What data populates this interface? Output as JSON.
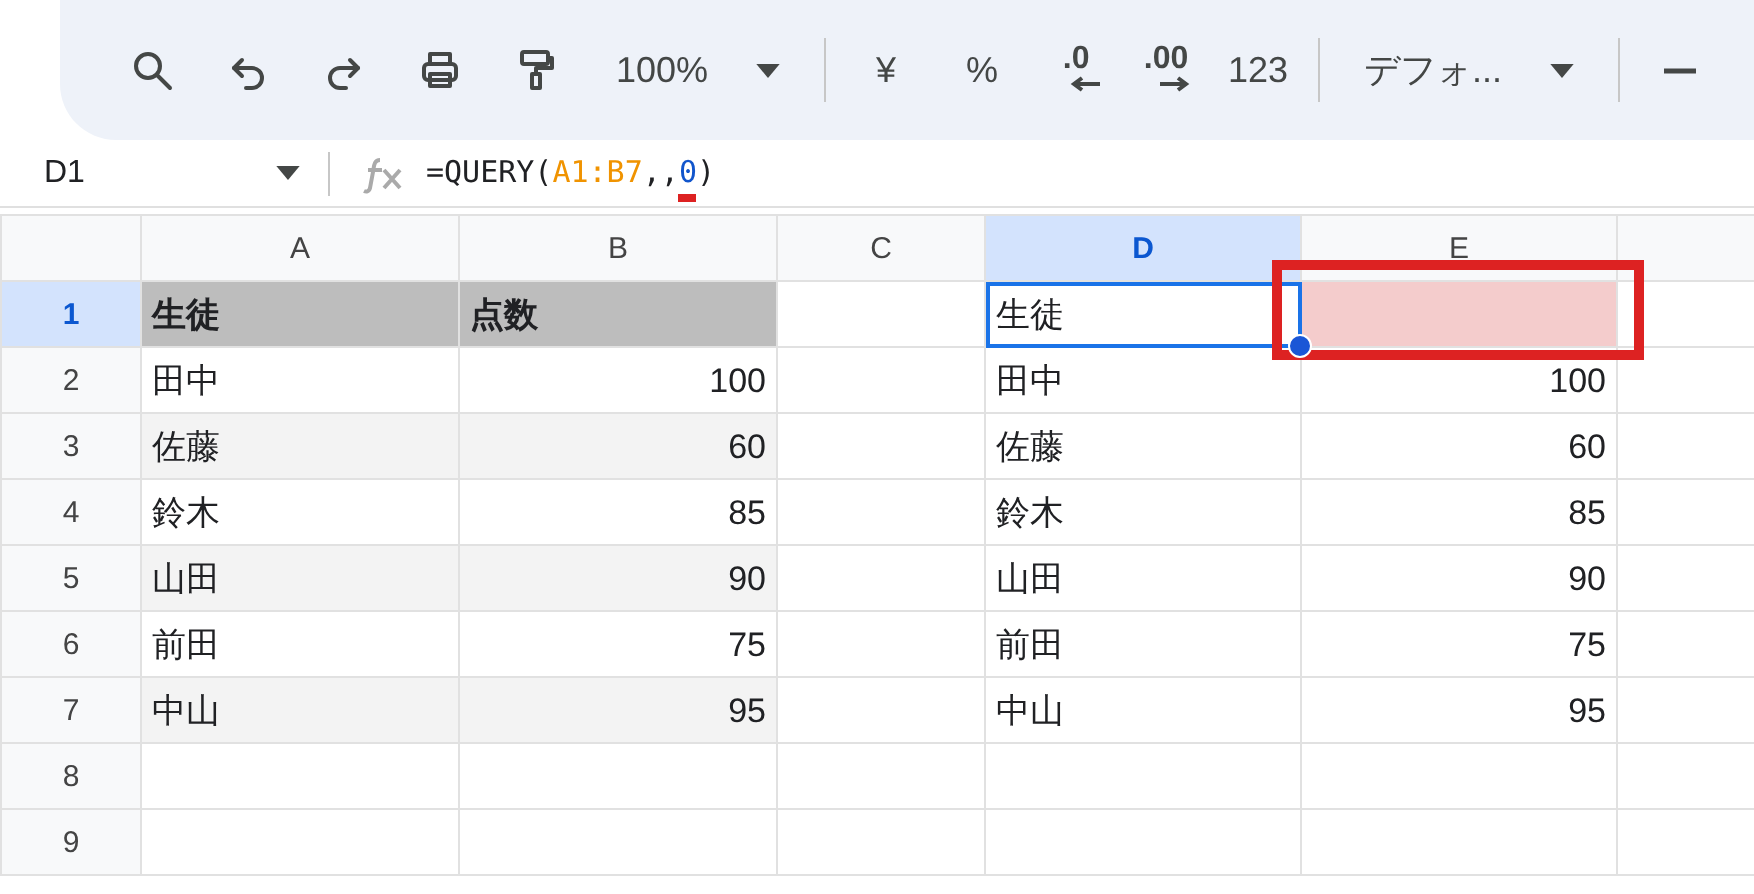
{
  "toolbar": {
    "items": [
      {
        "kind": "icon"
      },
      {
        "kind": "icon"
      },
      {
        "kind": "icon"
      },
      {
        "kind": "icon"
      },
      {
        "kind": "icon"
      },
      {
        "kind": "dropdown",
        "text": "100%"
      },
      {
        "kind": "divider"
      },
      {
        "kind": "text",
        "text": "¥"
      },
      {
        "kind": "text",
        "text": "%"
      },
      {
        "kind": "decimal",
        "text": ".0"
      },
      {
        "kind": "decimal",
        "text": ".00"
      },
      {
        "kind": "text",
        "text": "123"
      },
      {
        "kind": "divider"
      },
      {
        "kind": "dropdown",
        "text": "デフォ..."
      },
      {
        "kind": "divider"
      },
      {
        "kind": "icon"
      }
    ]
  },
  "formula_bar": {
    "name_box": "D1",
    "formula": [
      {
        "text": "=QUERY(",
        "kind": "plain",
        "underlined": false
      },
      {
        "text": "A1:B7",
        "kind": "range",
        "underlined": false
      },
      {
        "text": ",,",
        "kind": "plain",
        "underlined": false
      },
      {
        "text": "0",
        "kind": "number",
        "underlined": true
      },
      {
        "text": ")",
        "kind": "plain",
        "underlined": false
      }
    ]
  },
  "columns": [
    {
      "label": "A",
      "selected": false
    },
    {
      "label": "B",
      "selected": false
    },
    {
      "label": "C",
      "selected": false
    },
    {
      "label": "D",
      "selected": true
    },
    {
      "label": "E",
      "selected": false
    }
  ],
  "rows": [
    {
      "label": "1",
      "selected": true,
      "cells": [
        {
          "text": "生徒",
          "kind": "text"
        },
        {
          "text": "点数",
          "kind": "text"
        },
        null,
        {
          "text": "生徒",
          "kind": "text"
        },
        {
          "text": "",
          "kind": "text"
        }
      ]
    },
    {
      "label": "2",
      "selected": false,
      "cells": [
        {
          "text": "田中",
          "kind": "text"
        },
        {
          "text": "100",
          "kind": "number"
        },
        null,
        {
          "text": "田中",
          "kind": "text"
        },
        {
          "text": "100",
          "kind": "number"
        }
      ]
    },
    {
      "label": "3",
      "selected": false,
      "cells": [
        {
          "text": "佐藤",
          "kind": "text"
        },
        {
          "text": "60",
          "kind": "number"
        },
        null,
        {
          "text": "佐藤",
          "kind": "text"
        },
        {
          "text": "60",
          "kind": "number"
        }
      ]
    },
    {
      "label": "4",
      "selected": false,
      "cells": [
        {
          "text": "鈴木",
          "kind": "text"
        },
        {
          "text": "85",
          "kind": "number"
        },
        null,
        {
          "text": "鈴木",
          "kind": "text"
        },
        {
          "text": "85",
          "kind": "number"
        }
      ]
    },
    {
      "label": "5",
      "selected": false,
      "cells": [
        {
          "text": "山田",
          "kind": "text"
        },
        {
          "text": "90",
          "kind": "number"
        },
        null,
        {
          "text": "山田",
          "kind": "text"
        },
        {
          "text": "90",
          "kind": "number"
        }
      ]
    },
    {
      "label": "6",
      "selected": false,
      "cells": [
        {
          "text": "前田",
          "kind": "text"
        },
        {
          "text": "75",
          "kind": "number"
        },
        null,
        {
          "text": "前田",
          "kind": "text"
        },
        {
          "text": "75",
          "kind": "number"
        }
      ]
    },
    {
      "label": "7",
      "selected": false,
      "cells": [
        {
          "text": "中山",
          "kind": "text"
        },
        {
          "text": "95",
          "kind": "number"
        },
        null,
        {
          "text": "中山",
          "kind": "text"
        },
        {
          "text": "95",
          "kind": "number"
        }
      ]
    },
    {
      "label": "8",
      "selected": false,
      "cells": [
        null,
        null,
        null,
        null,
        null
      ]
    },
    {
      "label": "9",
      "selected": false,
      "cells": [
        null,
        null,
        null,
        null,
        null
      ]
    }
  ]
}
